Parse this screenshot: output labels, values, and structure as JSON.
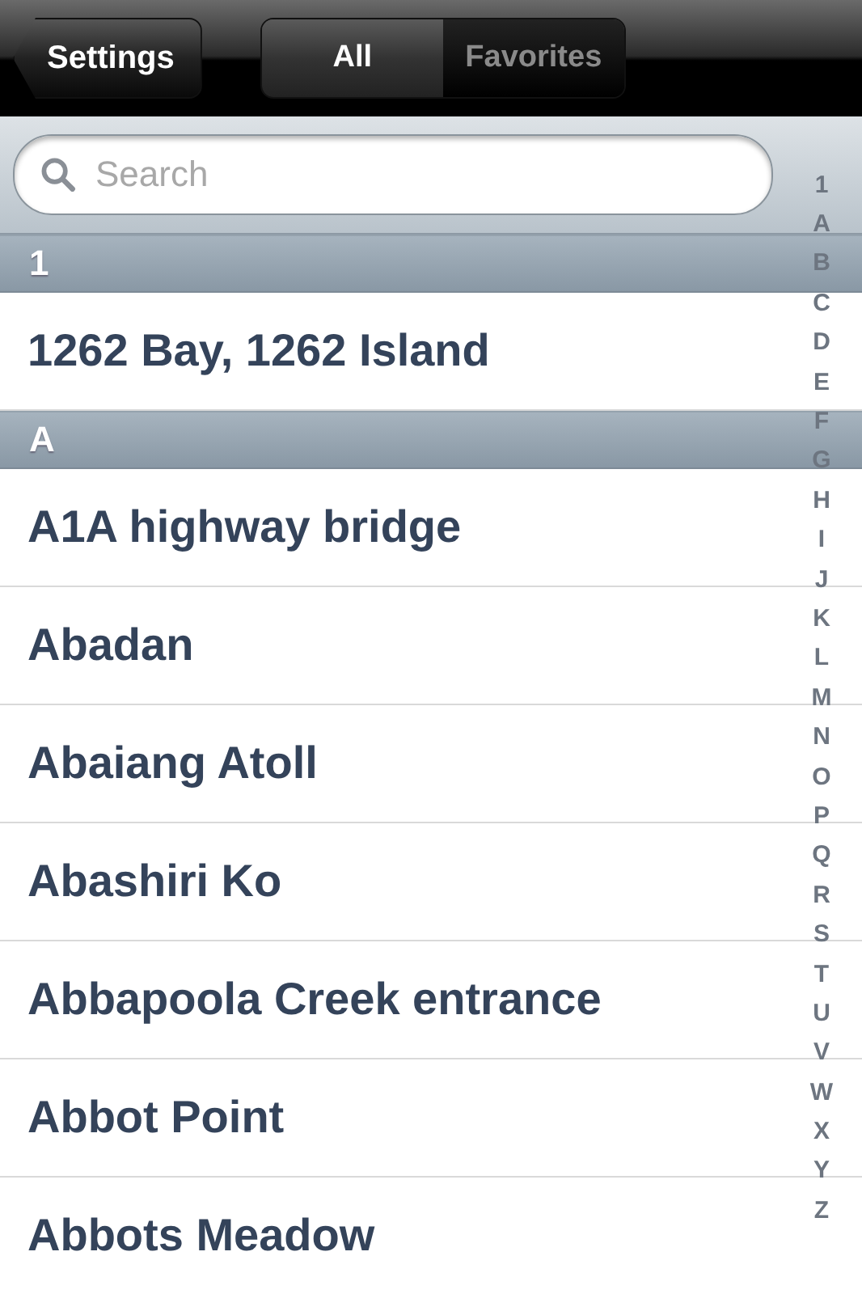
{
  "nav": {
    "back": "Settings",
    "segments": [
      {
        "label": "All",
        "selected": true
      },
      {
        "label": "Favorites",
        "selected": false
      }
    ]
  },
  "search": {
    "placeholder": "Search"
  },
  "sections": [
    {
      "header": "1",
      "rows": [
        "1262 Bay, 1262 Island"
      ]
    },
    {
      "header": "A",
      "rows": [
        "A1A highway bridge",
        "Abadan",
        "Abaiang Atoll",
        "Abashiri Ko",
        "Abbapoola Creek entrance",
        "Abbot Point",
        "Abbots Meadow"
      ]
    }
  ],
  "index": [
    "1",
    "A",
    "B",
    "C",
    "D",
    "E",
    "F",
    "G",
    "H",
    "I",
    "J",
    "K",
    "L",
    "M",
    "N",
    "O",
    "P",
    "Q",
    "R",
    "S",
    "T",
    "U",
    "V",
    "W",
    "X",
    "Y",
    "Z"
  ]
}
